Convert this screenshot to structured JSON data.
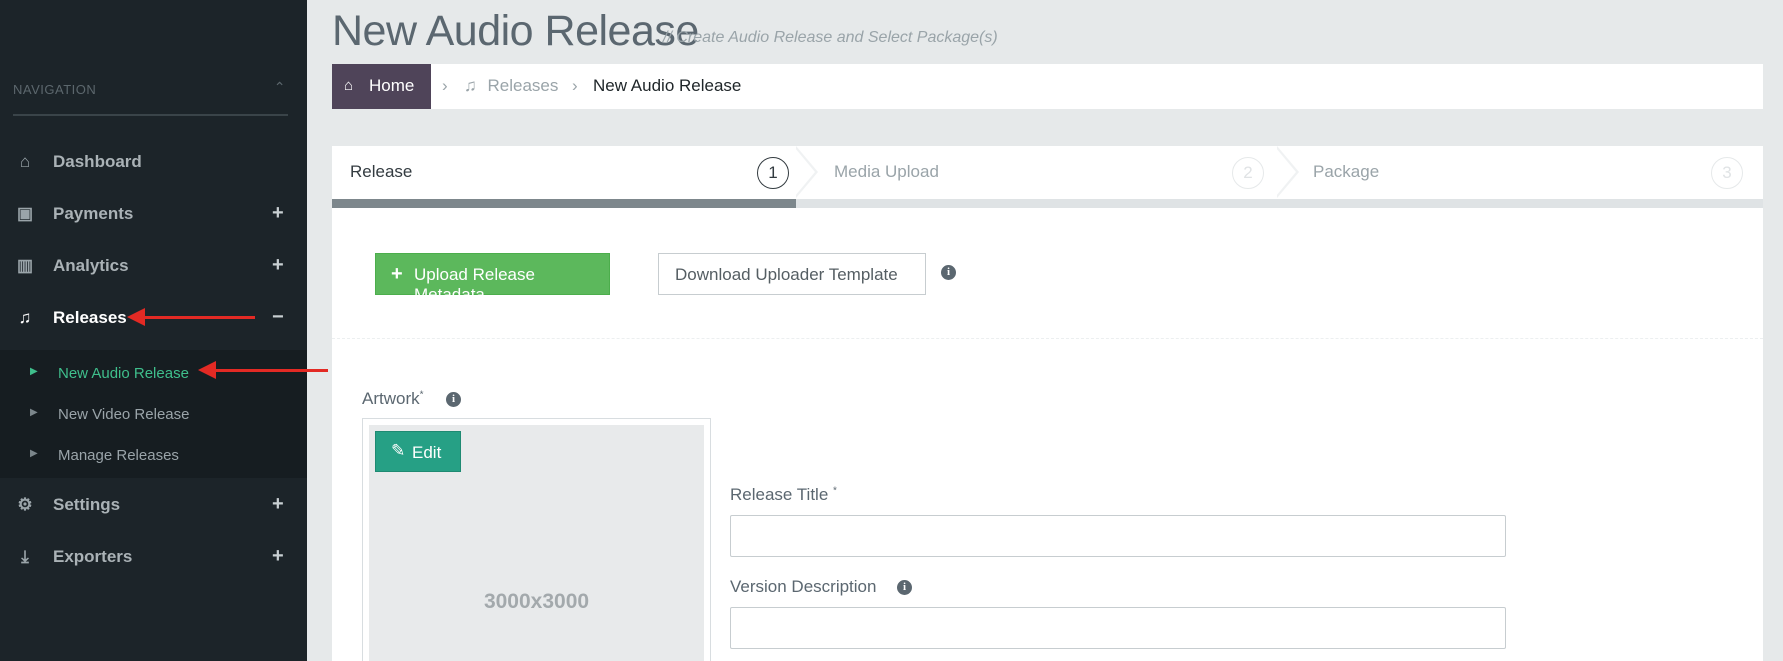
{
  "sidebar": {
    "heading": "NAVIGATION",
    "heading_toggle": "⌃",
    "items": [
      {
        "label": "Dashboard",
        "icon": "home-icon",
        "glyph": "⌂",
        "toggle": ""
      },
      {
        "label": "Payments",
        "icon": "money-icon",
        "glyph": "▣",
        "toggle": "+"
      },
      {
        "label": "Analytics",
        "icon": "bar-chart-icon",
        "glyph": "▥",
        "toggle": "+"
      },
      {
        "label": "Releases",
        "icon": "music-icon",
        "glyph": "♫",
        "toggle": "−"
      },
      {
        "label": "Settings",
        "icon": "gear-icon",
        "glyph": "⚙",
        "toggle": "+"
      },
      {
        "label": "Exporters",
        "icon": "download-icon",
        "glyph": "⤓",
        "toggle": "+"
      }
    ],
    "subitems": [
      {
        "label": "New Audio Release",
        "caret": "▶"
      },
      {
        "label": "New Video Release",
        "caret": "▶"
      },
      {
        "label": "Manage Releases",
        "caret": "▶"
      }
    ]
  },
  "header": {
    "title": "New Audio Release",
    "subtitle": "// Create Audio Release and Select Package(s)"
  },
  "breadcrumb": {
    "home": "Home",
    "home_icon": "⌂",
    "sep": "›",
    "releases": "Releases",
    "releases_icon": "♫",
    "current": "New Audio Release"
  },
  "wizard": {
    "steps": [
      {
        "label": "Release",
        "number": "1"
      },
      {
        "label": "Media Upload",
        "number": "2"
      },
      {
        "label": "Package",
        "number": "3"
      }
    ]
  },
  "panel": {
    "upload_button": "Upload Release Metadata...",
    "upload_plus": "+",
    "download_button": "Download Uploader Template",
    "info_glyph": "i",
    "artwork_label": "Artwork",
    "required_mark": "*",
    "edit_button": "Edit",
    "edit_icon": "✎",
    "artwork_dimensions": "3000x3000",
    "release_title_label": "Release Title",
    "version_description_label": "Version Description",
    "release_title_value": "",
    "version_description_value": ""
  },
  "colors": {
    "sidebar_bg": "#1c2429",
    "active_link": "#3fbf8c",
    "upload_green": "#5cb85c",
    "edit_teal": "#26a085",
    "home_purple": "#4f4459",
    "annotation_red": "#e32a24"
  }
}
